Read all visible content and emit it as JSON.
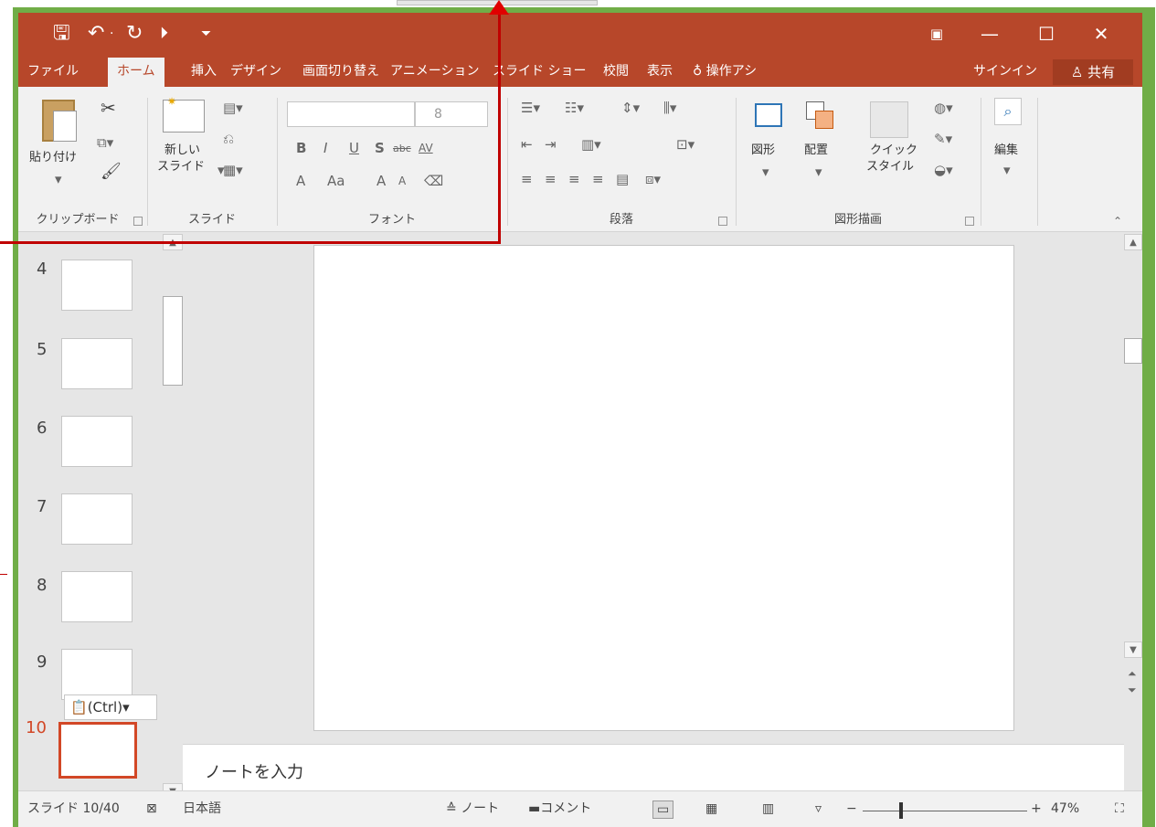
{
  "qat": {
    "save_icon": "save-icon",
    "undo_icon": "undo-icon",
    "undo_arrow": "·",
    "redo_icon": "redo-icon",
    "present_icon": "present-from-start-icon",
    "customize_icon": "customize-qat-icon"
  },
  "window_controls": {
    "ribbon_display_icon": "ribbon-display-options-icon",
    "minimize": "—",
    "maximize": "☐",
    "close": "✕"
  },
  "tabs": [
    "ファイル",
    "ホーム",
    "挿入",
    "デザイン",
    "画面切り替え",
    "アニメーション",
    "スライド ショー",
    "校閲",
    "表示"
  ],
  "tell_me": "操作アシ",
  "signin": "サインイン",
  "share": "共有",
  "ribbon": {
    "clipboard": {
      "paste": "貼り付け",
      "group": "クリップボード"
    },
    "slides": {
      "new_slide_l1": "新しい",
      "new_slide_l2": "スライド",
      "group": "スライド"
    },
    "font": {
      "size": "8",
      "bold": "B",
      "italic": "I",
      "underline": "U",
      "shadow": "S",
      "strike": "abc",
      "spacing": "AV",
      "color": "A",
      "case": "Aa",
      "grow": "A",
      "shrink": "A",
      "group": "フォント"
    },
    "paragraph": {
      "group": "段落"
    },
    "drawing": {
      "shapes": "図形",
      "arrange": "配置",
      "quick_l1": "クイック",
      "quick_l2": "スタイル",
      "group": "図形描画"
    },
    "editing": {
      "label": "編集"
    }
  },
  "slides_list": [
    {
      "num": "4"
    },
    {
      "num": "5"
    },
    {
      "num": "6"
    },
    {
      "num": "7"
    },
    {
      "num": "8"
    },
    {
      "num": "9"
    },
    {
      "num": "10",
      "selected": true
    }
  ],
  "paste_options": "(Ctrl)",
  "notes_placeholder": "ノートを入力",
  "status": {
    "slide_counter": "スライド 10/40",
    "language": "日本語",
    "notes_btn": "ノート",
    "comments_btn": "コメント",
    "zoom": "47%"
  },
  "colors": {
    "accent": "#b7472a",
    "frame": "#70ad47",
    "annotation": "#c00000",
    "selected_thumb": "#d24726"
  }
}
